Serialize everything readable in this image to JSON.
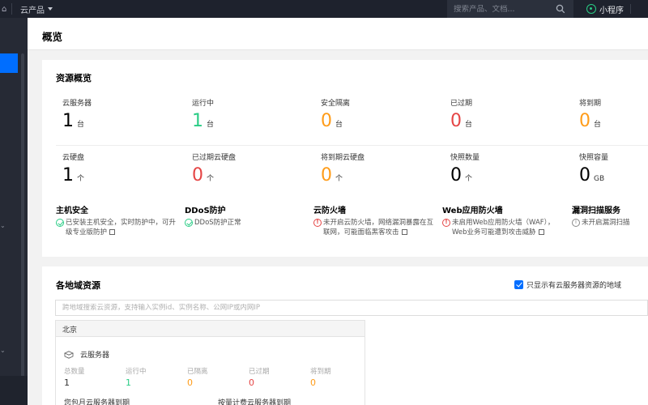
{
  "topbar": {
    "products_label": "云产品",
    "search_placeholder": "搜索产品、文档...",
    "mini_program_label": "小程序"
  },
  "page": {
    "title": "概览"
  },
  "overview": {
    "title": "资源概览",
    "row1": [
      {
        "label": "云服务器",
        "value": "1",
        "unit": "台",
        "color": "#000000"
      },
      {
        "label": "运行中",
        "value": "1",
        "unit": "台",
        "color": "#29cc85"
      },
      {
        "label": "安全隔离",
        "value": "0",
        "unit": "台",
        "color": "#ff9c19"
      },
      {
        "label": "已过期",
        "value": "0",
        "unit": "台",
        "color": "#e54545"
      },
      {
        "label": "将到期",
        "value": "0",
        "unit": "台",
        "color": "#ff9c19"
      }
    ],
    "row2": [
      {
        "label": "云硬盘",
        "value": "1",
        "unit": "个",
        "color": "#000000"
      },
      {
        "label": "已过期云硬盘",
        "value": "0",
        "unit": "个",
        "color": "#e54545"
      },
      {
        "label": "将到期云硬盘",
        "value": "0",
        "unit": "个",
        "color": "#ff9c19"
      },
      {
        "label": "快照数量",
        "value": "0",
        "unit": "个",
        "color": "#000000"
      },
      {
        "label": "快照容量",
        "value": "0",
        "unit": "GB",
        "color": "#000000"
      }
    ],
    "security": [
      {
        "title": "主机安全",
        "status": "ok",
        "desc": "已安装主机安全，实时防护中，可升级专业版防护"
      },
      {
        "title": "DDoS防护",
        "status": "ok",
        "desc": "DDoS防护正常"
      },
      {
        "title": "云防火墙",
        "status": "warn",
        "desc": "未开启云防火墙，网络漏洞暴露在互联网，可能面临黑客攻击"
      },
      {
        "title": "Web应用防火墙",
        "status": "warn",
        "desc": "未启用Web应用防火墙（WAF），Web业务可能遭到攻击威胁"
      },
      {
        "title": "漏洞扫描服务",
        "status": "info",
        "desc": "未开启漏洞扫描"
      }
    ]
  },
  "regions": {
    "title": "各地域资源",
    "checkbox_label": "只显示有云服务器资源的地域",
    "search_placeholder": "跨地域搜索云资源，支持输入实例id、实例名称、公网IP或内网IP",
    "region_name": "北京",
    "service_name": "云服务器",
    "stats": [
      {
        "label": "总数量",
        "value": "1",
        "color": "#333333"
      },
      {
        "label": "运行中",
        "value": "1",
        "color": "#29cc85"
      },
      {
        "label": "已隔离",
        "value": "0",
        "color": "#ff9c19"
      },
      {
        "label": "已过期",
        "value": "0",
        "color": "#e54545"
      },
      {
        "label": "将到期",
        "value": "0",
        "color": "#ff9c19"
      }
    ],
    "bottom_left": "您包月云服务器到期",
    "bottom_right": "按量计费云服务器到期"
  }
}
